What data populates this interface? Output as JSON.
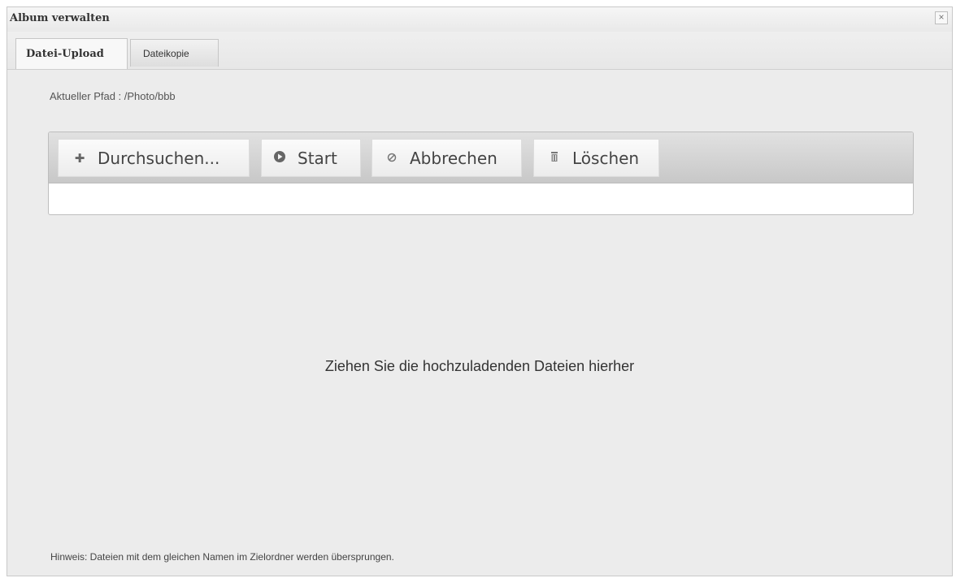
{
  "dialog": {
    "title": "Album verwalten",
    "close_symbol": "×"
  },
  "tabs": [
    {
      "label": "Datei-Upload",
      "active": true
    },
    {
      "label": "Dateikopie",
      "active": false
    }
  ],
  "current_path": "Aktueller Pfad : /Photo/bbb",
  "toolbar": {
    "browse_label": "Durchsuchen...",
    "start_label": "Start",
    "cancel_label": "Abbrechen",
    "delete_label": "Löschen",
    "icons": {
      "browse": "plus-icon",
      "start": "play-circle-icon",
      "cancel": "ban-icon",
      "delete": "trash-icon"
    }
  },
  "dropzone_text": "Ziehen Sie die hochzuladenden Dateien hierher",
  "hint": "Hinweis: Dateien mit dem gleichen Namen im Zielordner werden übersprungen."
}
